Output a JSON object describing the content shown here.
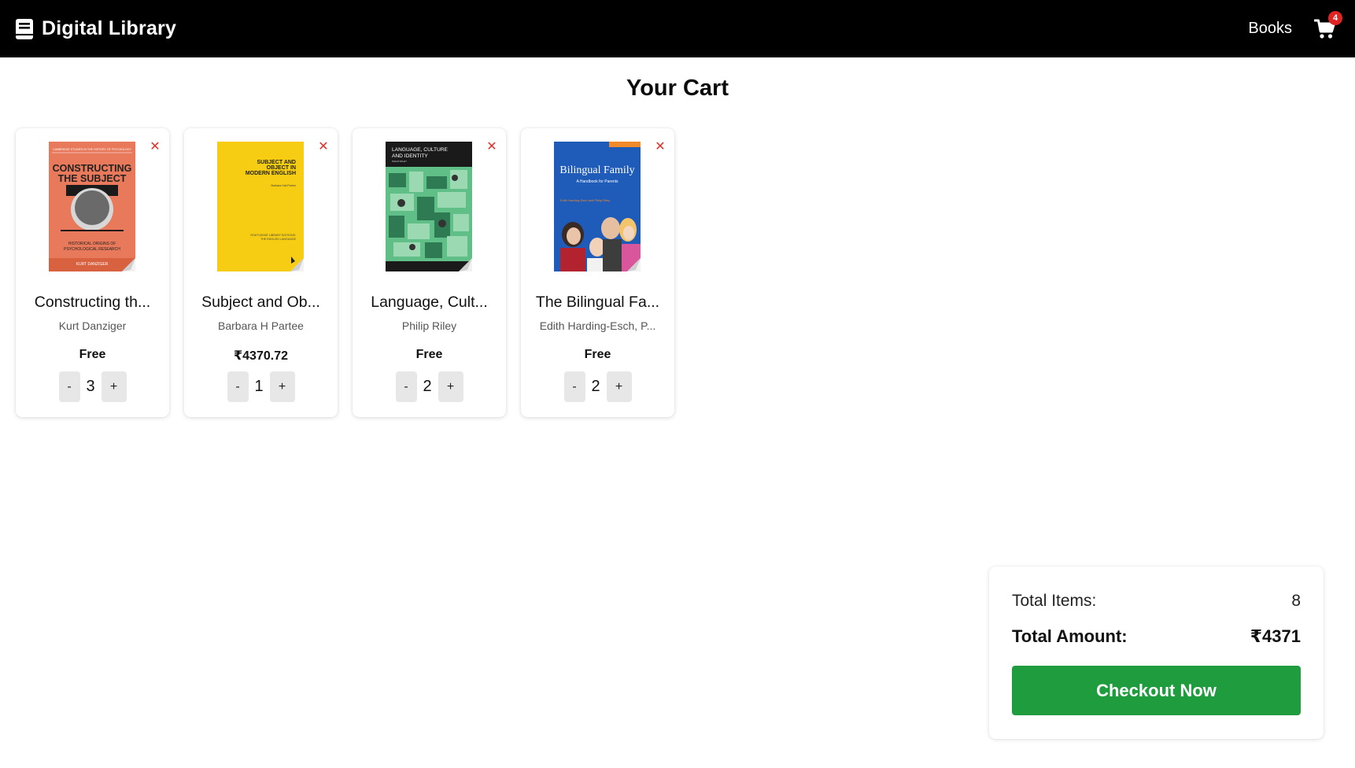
{
  "header": {
    "brand_title": "Digital Library",
    "brand_icon": "book-icon",
    "nav_books": "Books",
    "cart_icon": "shopping-cart-icon",
    "cart_count": "4"
  },
  "page_title": "Your Cart",
  "cart_items": [
    {
      "title": "Constructing th...",
      "author": "Kurt Danziger",
      "price": "Free",
      "quantity": "3",
      "cover": {
        "bg": "#e8795a",
        "top_text": "CAMBRIDGE STUDIES IN THE HISTORY OF PSYCHOLOGY",
        "main_text_1": "CONSTRUCTING",
        "main_text_2": "THE SUBJECT",
        "sub_text_1": "HISTORICAL ORIGINS OF",
        "sub_text_2": "PSYCHOLOGICAL RESEARCH",
        "author_text": "KURT DANZIGER"
      }
    },
    {
      "title": "Subject and Ob...",
      "author": "Barbara H Partee",
      "price": "₹4370.72",
      "quantity": "1",
      "cover": {
        "bg": "#f6cd12",
        "main_text_1": "SUBJECT AND",
        "main_text_2": "OBJECT IN",
        "main_text_3": "MODERN ENGLISH",
        "author_text": "Barbara Hall Partee",
        "sub_text_1": "ROUTLEDGE LIBRARY EDITIONS:",
        "sub_text_2": "THE ENGLISH LANGUAGE"
      }
    },
    {
      "title": "Language, Cult...",
      "author": "Philip Riley",
      "price": "Free",
      "quantity": "2",
      "cover": {
        "bg": "#1a1a1a",
        "main_text_1": "LANGUAGE, CULTURE",
        "main_text_2": "AND IDENTITY",
        "author_text": "PHILIP RILEY"
      }
    },
    {
      "title": "The Bilingual Fa...",
      "author": "Edith Harding-Esch, P...",
      "price": "Free",
      "quantity": "2",
      "cover": {
        "bg": "#1f5bb8",
        "main_text_1": "Bilingual Family",
        "sub_text_1": "A Handbook for Parents",
        "author_text": "Edith Harding-Esch and Philip Riley"
      }
    }
  ],
  "summary": {
    "items_label": "Total Items:",
    "items_value": "8",
    "amount_label": "Total Amount:",
    "amount_value": "₹4371",
    "checkout_label": "Checkout Now"
  },
  "qty_minus_label": "-",
  "qty_plus_label": "+",
  "remove_label": "✕",
  "colors": {
    "header_bg": "#000000",
    "badge": "#e02424",
    "remove": "#e0302c",
    "checkout": "#1f9d3e"
  }
}
